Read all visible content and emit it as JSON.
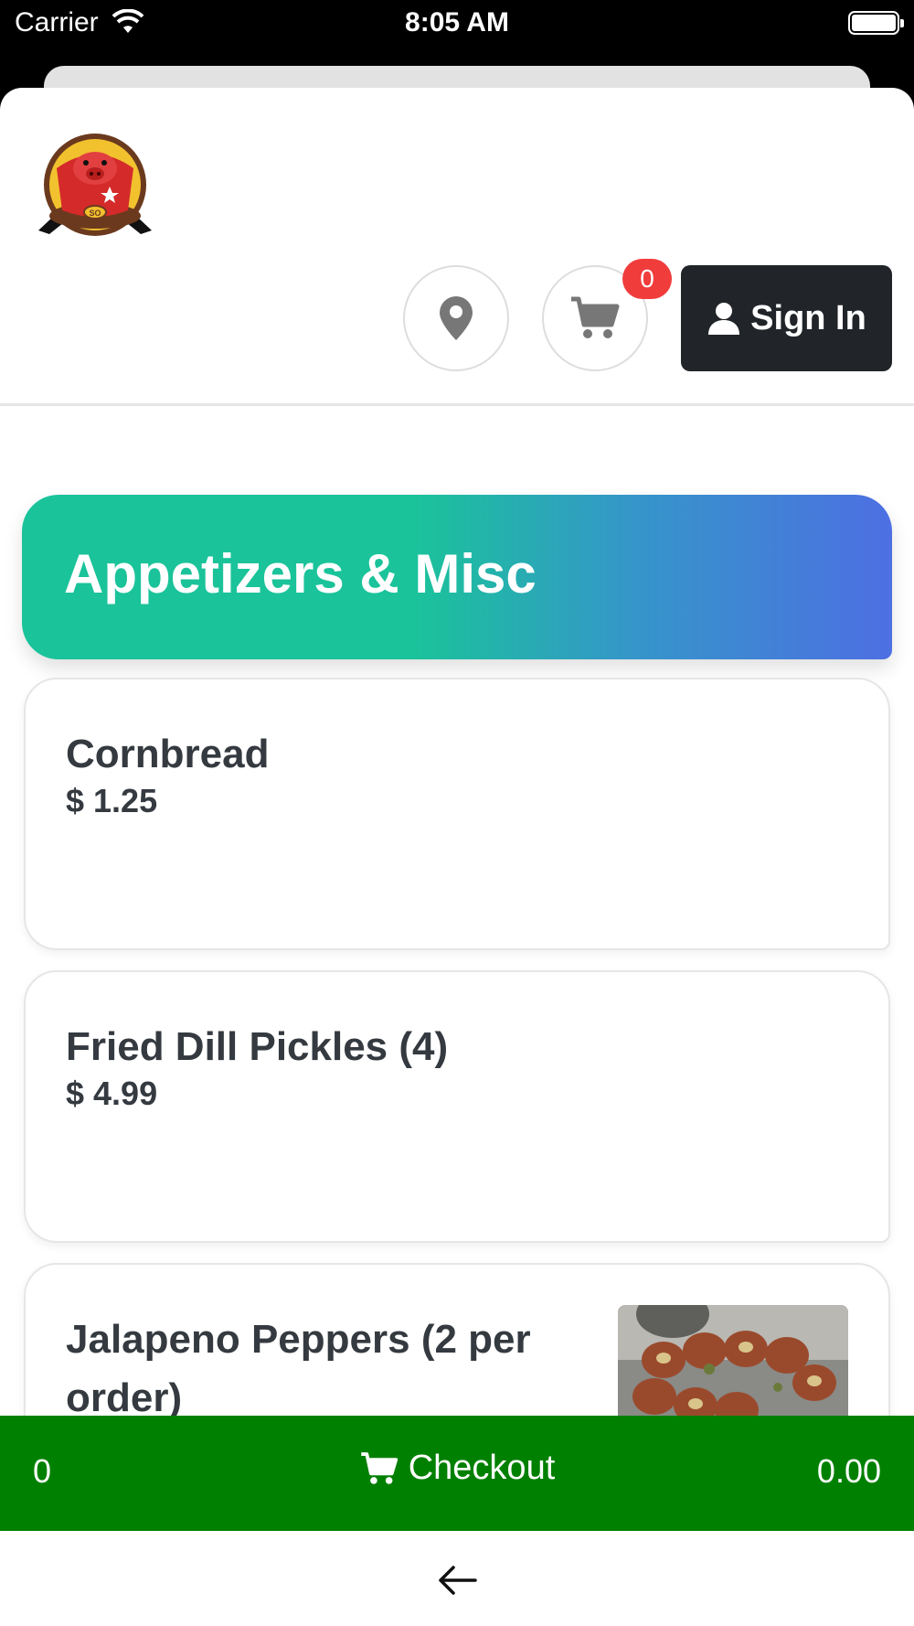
{
  "status_bar": {
    "carrier": "Carrier",
    "time": "8:05 AM"
  },
  "header": {
    "logo_text": "SO",
    "cart_count": "0",
    "signin_label": "Sign In",
    "icons": [
      "location-pin-icon",
      "cart-icon",
      "user-icon"
    ]
  },
  "category": {
    "title": "Appetizers & Misc",
    "gradient": [
      "#1ac39a",
      "#4d6fe2"
    ]
  },
  "items": [
    {
      "name": "Cornbread",
      "price": "$ 1.25"
    },
    {
      "name": "Fried Dill Pickles (4)",
      "price": "$ 4.99"
    },
    {
      "name": "Jalapeno Peppers (2 per order)",
      "price": ""
    }
  ],
  "checkout_bar": {
    "count": "0",
    "label": "Checkout",
    "total": "0.00",
    "color": "#008000"
  },
  "colors": {
    "badge": "#f13c3c",
    "signin_bg": "#212529"
  }
}
